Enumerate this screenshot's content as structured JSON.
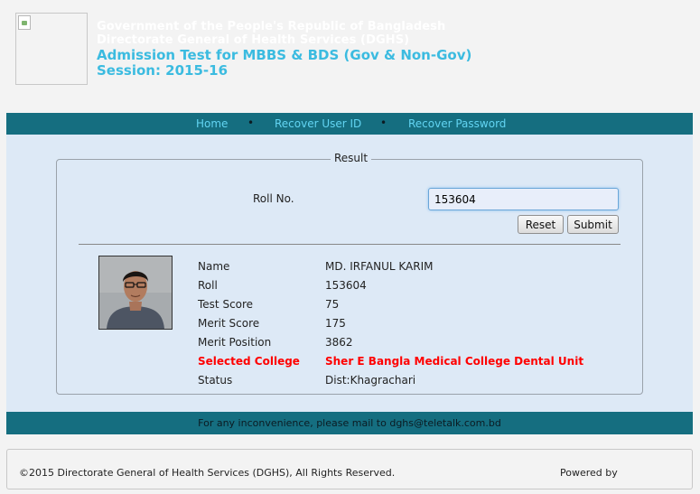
{
  "header": {
    "line1": "Government of the People's Republic of Bangladesh",
    "line2": "Directorate General of Health Services (DGHS)",
    "line3": "Admission Test for MBBS & BDS (Gov & Non-Gov)",
    "line4": "Session: 2015-16"
  },
  "nav": {
    "items": [
      "Home",
      "Recover User ID",
      "Recover Password"
    ],
    "separator": "•"
  },
  "result": {
    "legend": "Result",
    "roll_label": "Roll No.",
    "roll_value": "153604",
    "reset_label": "Reset",
    "submit_label": "Submit",
    "rows": [
      {
        "label": "Name",
        "value": "MD. IRFANUL KARIM"
      },
      {
        "label": "Roll",
        "value": "153604"
      },
      {
        "label": "Test Score",
        "value": "75"
      },
      {
        "label": "Merit Score",
        "value": "175"
      },
      {
        "label": "Merit Position",
        "value": "3862"
      },
      {
        "label": "Selected College",
        "value": "Sher E Bangla Medical College Dental Unit"
      },
      {
        "label": "Status",
        "value": "Dist:Khagrachari"
      }
    ]
  },
  "footer": {
    "mail_text": "For any inconvenience, please mail to dghs@teletalk.com.bd",
    "copyright": "©2015 Directorate General of Health Services (DGHS), All Rights Reserved.",
    "powered_by": "Powered by"
  },
  "colors": {
    "nav_bg": "#156e80",
    "nav_link": "#62d4f2",
    "title_blue": "#3bbbe0",
    "panel_bg": "#dde9f6",
    "highlight_red": "#ff0000"
  }
}
